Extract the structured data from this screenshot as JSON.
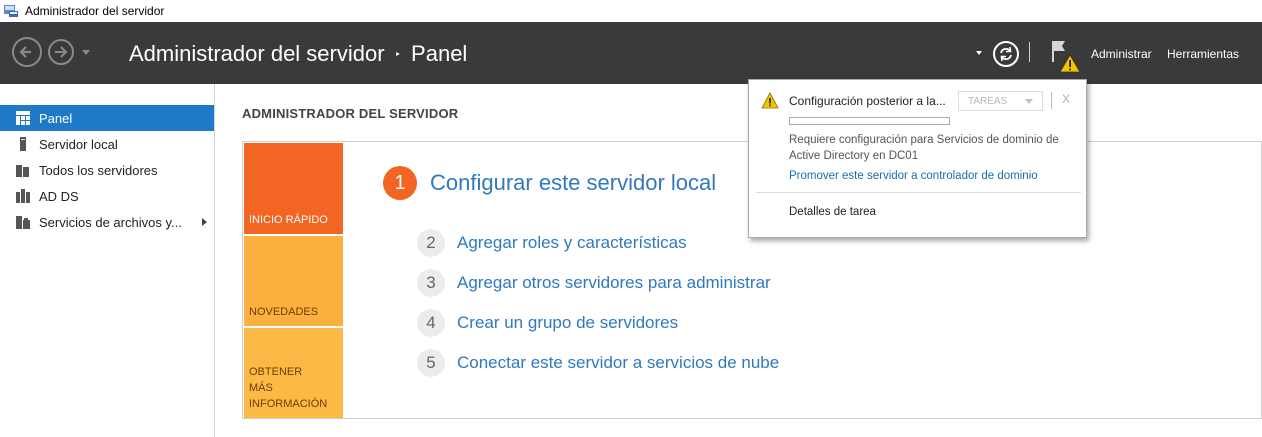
{
  "window": {
    "title": "Administrador del servidor"
  },
  "header": {
    "breadcrumb_root": "Administrador del servidor",
    "breadcrumb_separator": "‣",
    "breadcrumb_current": "Panel",
    "menu_manage": "Administrar",
    "menu_tools": "Herramientas",
    "icons": [
      "back-icon",
      "forward-icon",
      "refresh-icon",
      "flag-warning-icon"
    ]
  },
  "sidebar": {
    "items": [
      {
        "label": "Panel",
        "icon": "dashboard-icon",
        "active": true
      },
      {
        "label": "Servidor local",
        "icon": "server-icon"
      },
      {
        "label": "Todos los servidores",
        "icon": "servers-icon"
      },
      {
        "label": "AD DS",
        "icon": "ad-ds-icon"
      },
      {
        "label": "Servicios de archivos y...",
        "icon": "file-services-icon"
      }
    ]
  },
  "main": {
    "heading": "ADMINISTRADOR DEL SERVIDOR",
    "tiles": [
      "INICIO RÁPIDO",
      "NOVEDADES",
      "OBTENER MÁS INFORMACIÓN"
    ],
    "steps": [
      {
        "num": "1",
        "label": "Configurar este servidor local"
      },
      {
        "num": "2",
        "label": "Agregar roles y características"
      },
      {
        "num": "3",
        "label": "Agregar otros servidores para administrar"
      },
      {
        "num": "4",
        "label": "Crear un grupo de servidores"
      },
      {
        "num": "5",
        "label": "Conectar este servidor a servicios de nube"
      }
    ]
  },
  "notification": {
    "title": "Configuración posterior a la...",
    "tasks_label": "TAREAS",
    "close_label": "X",
    "progress": 0,
    "description": "Requiere configuración para Servicios de dominio de Active Directory en DC01",
    "link": "Promover este servidor a controlador de dominio",
    "details": "Detalles de tarea"
  },
  "colors": {
    "header_bg": "#3a3a3a",
    "sidebar_active": "#1e79c6",
    "tile_orange": "#f26522",
    "tile_yellow": "#fbb040",
    "link_blue": "#2f79c0",
    "warning_yellow": "#f5c400"
  }
}
